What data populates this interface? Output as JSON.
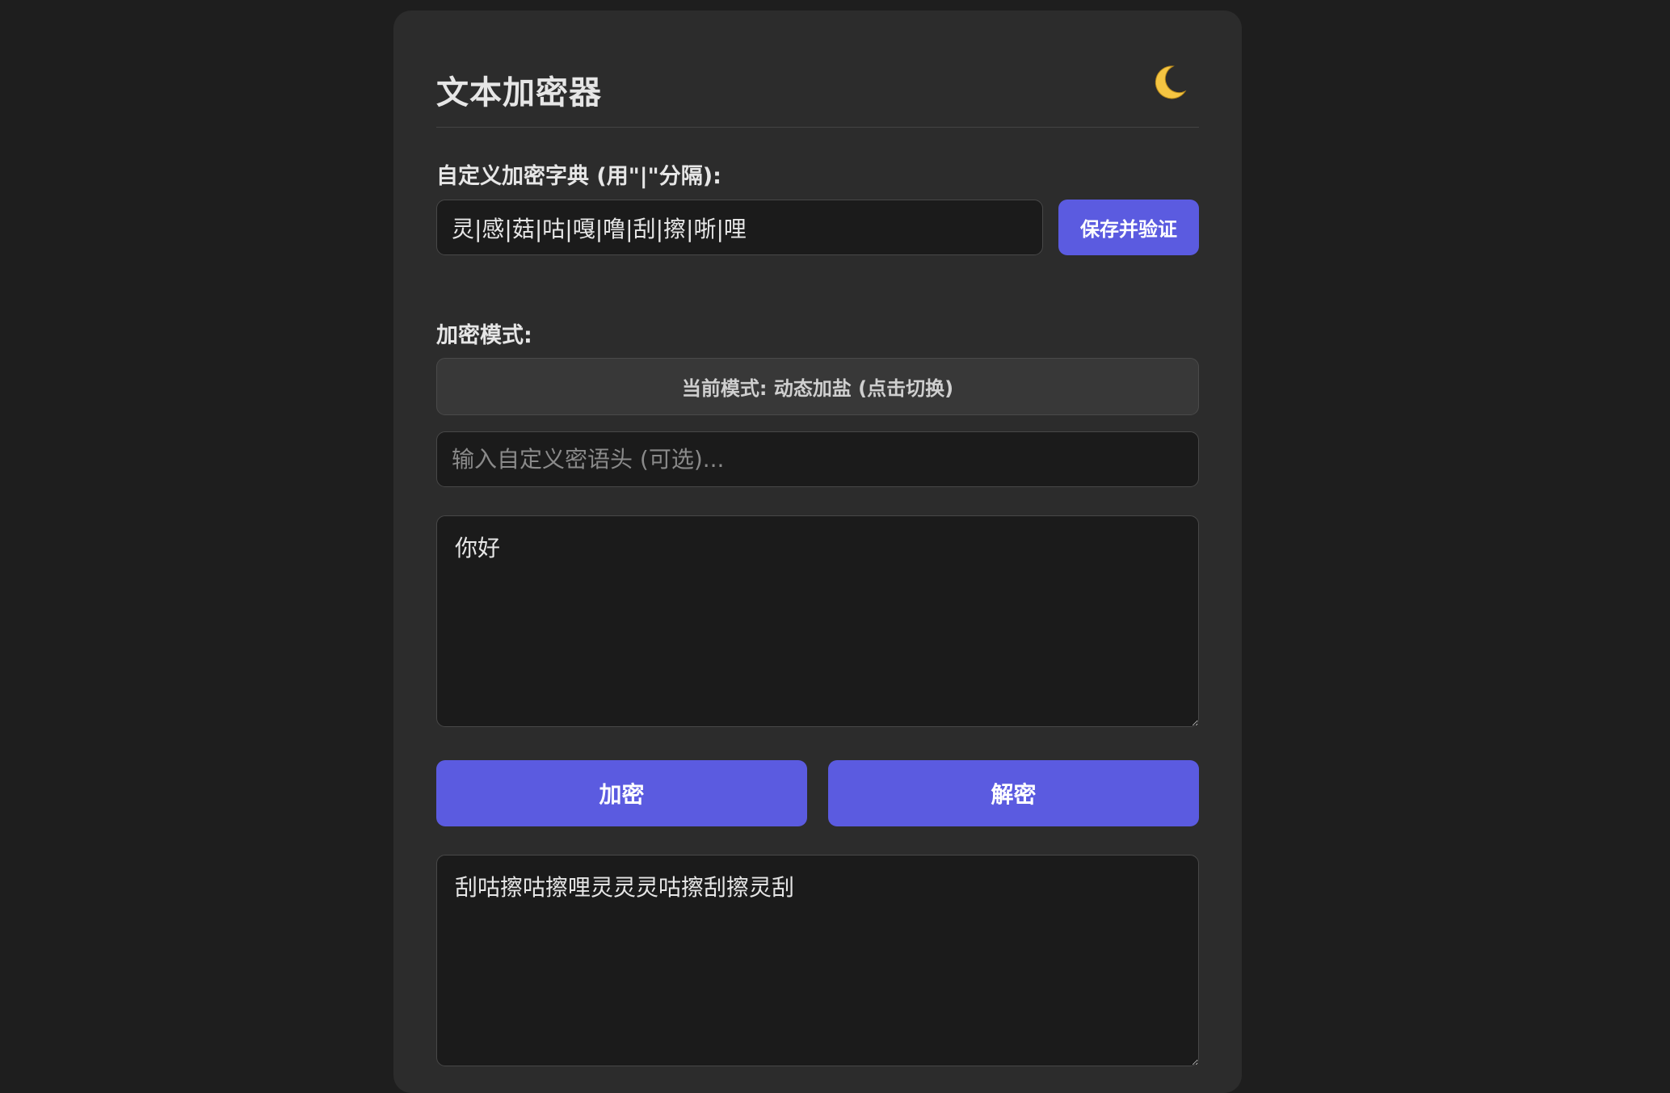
{
  "header": {
    "title": "文本加密器",
    "theme_icon": "moon-icon",
    "theme_glyph": "🌙"
  },
  "dictionary": {
    "label": "自定义加密字典 (用\"|\"分隔):",
    "value": "灵|感|菇|咕|嘎|噜|刮|擦|哳|哩",
    "save_button": "保存并验证"
  },
  "mode": {
    "label": "加密模式:",
    "toggle_text": "当前模式: 动态加盐 (点击切换)"
  },
  "passphrase": {
    "placeholder": "输入自定义密语头 (可选)...",
    "value": ""
  },
  "input_text": {
    "value": "你好"
  },
  "actions": {
    "encrypt_label": "加密",
    "decrypt_label": "解密"
  },
  "output_text": {
    "value": "刮咕擦咕擦哩灵灵灵咕擦刮擦灵刮"
  },
  "colors": {
    "background": "#1e1e1e",
    "card": "#2c2c2c",
    "field": "#1b1b1b",
    "accent": "#5b5be0",
    "text": "#e6e6e6"
  }
}
